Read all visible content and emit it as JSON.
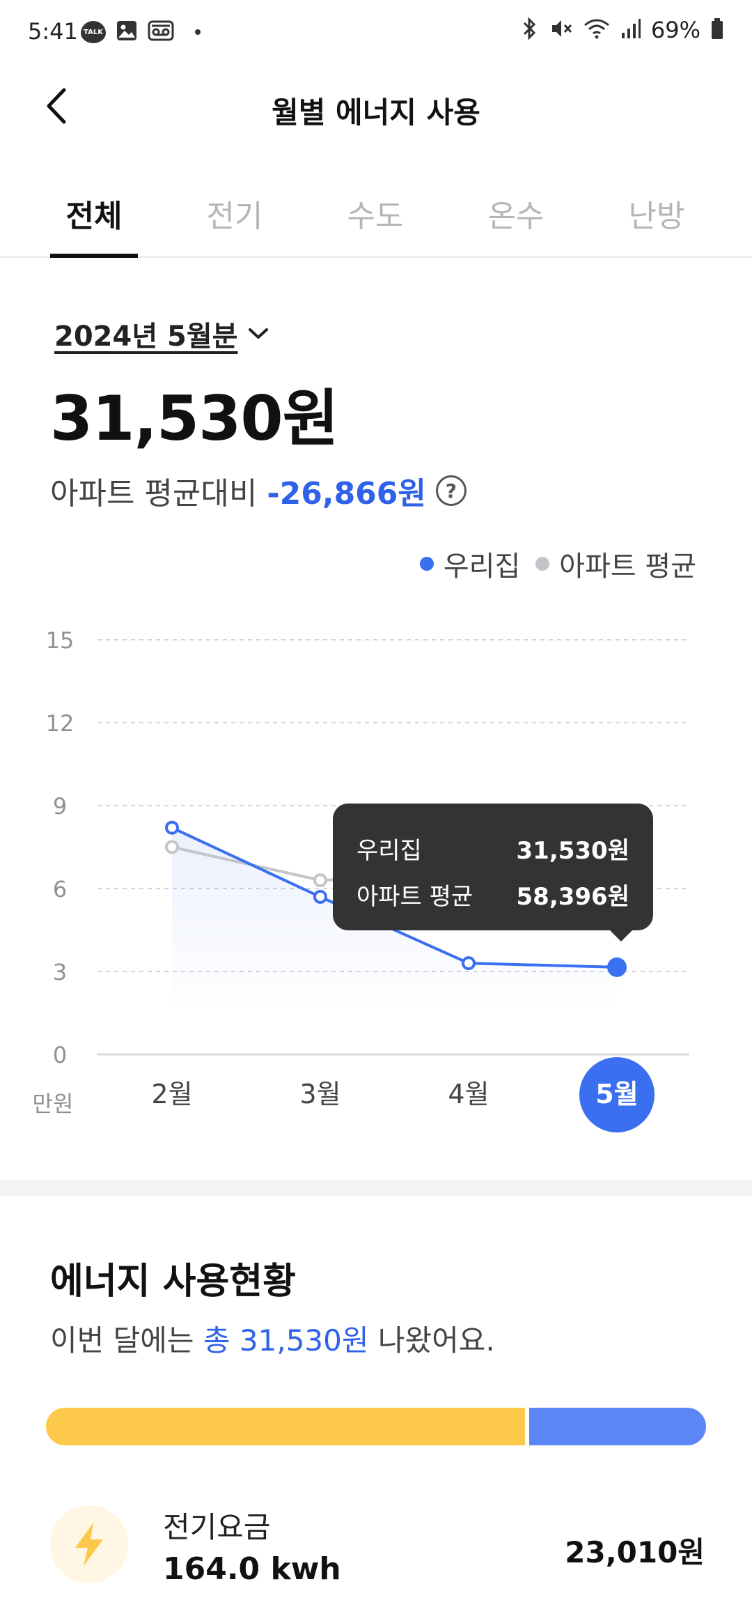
{
  "status_bar": {
    "time": "5:41",
    "talk_badge": "TALK",
    "battery": "69%"
  },
  "header": {
    "title": "월별 에너지 사용"
  },
  "tabs": [
    {
      "label": "전체",
      "active": true
    },
    {
      "label": "전기",
      "active": false
    },
    {
      "label": "수도",
      "active": false
    },
    {
      "label": "온수",
      "active": false
    },
    {
      "label": "난방",
      "active": false
    }
  ],
  "summary": {
    "month": "2024년 5월분",
    "total": "31,530원",
    "compare_label": "아파트 평균대비",
    "compare_value": "-26,866원",
    "help": "?"
  },
  "legend": {
    "mine": "우리집",
    "average": "아파트 평균"
  },
  "colors": {
    "accent": "#2f62e8",
    "mine": "#3a6ff0",
    "average": "#c3c5ca",
    "electric": "#fcc94a",
    "other": "#5b87f5"
  },
  "chart_data": {
    "type": "line",
    "categories": [
      "2월",
      "3월",
      "4월",
      "5월"
    ],
    "series": [
      {
        "name": "우리집",
        "values": [
          8.2,
          5.7,
          3.3,
          3.153
        ]
      },
      {
        "name": "아파트 평균",
        "values": [
          7.5,
          6.3,
          6.5,
          5.8396
        ]
      }
    ],
    "y_ticks": [
      "0",
      "3",
      "6",
      "9",
      "12",
      "15"
    ],
    "ylim": [
      0,
      15
    ],
    "y_unit": "만원",
    "selected_index": 3,
    "grid": true,
    "legend_position": "top-right"
  },
  "tooltip": {
    "mine_label": "우리집",
    "mine_value": "31,530원",
    "avg_label": "아파트 평균",
    "avg_value": "58,396원"
  },
  "usage": {
    "title": "에너지 사용현황",
    "sentence_before": "이번 달에는 ",
    "sentence_highlight": "총 31,530원",
    "sentence_after": " 나왔어요.",
    "bar_fractions": [
      0.73,
      0.27
    ],
    "items": [
      {
        "name": "전기요금",
        "usage": "164.0 kwh",
        "cost": "23,010원"
      }
    ]
  }
}
